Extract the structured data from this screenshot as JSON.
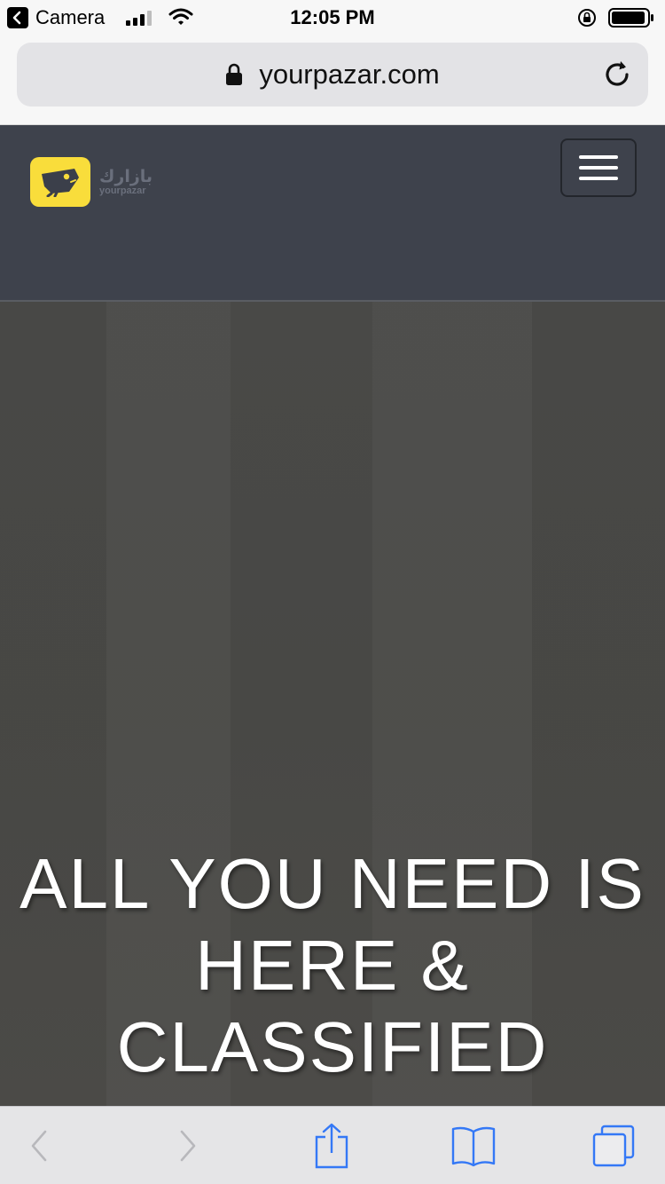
{
  "status_bar": {
    "back_app_label": "Camera",
    "time": "12:05 PM",
    "icons": [
      "back-arrow-icon",
      "signal-bars-icon",
      "wifi-icon",
      "rotation-lock-icon",
      "battery-icon"
    ]
  },
  "address_bar": {
    "url": "yourpazar.com",
    "icons": [
      "lock-icon",
      "reload-icon"
    ]
  },
  "site_header": {
    "logo_script": "بازارك",
    "logo_latin": "yourpazar",
    "logo_color": "#f9dd3b",
    "menu_icon": "hamburger-menu-icon"
  },
  "hero": {
    "heading": "ALL YOU NEED IS HERE & CLASSIFIED"
  },
  "toolbar": {
    "buttons": [
      "back-icon",
      "forward-icon",
      "share-icon",
      "bookmarks-icon",
      "tabs-icon"
    ],
    "accent": "#3478f6"
  }
}
